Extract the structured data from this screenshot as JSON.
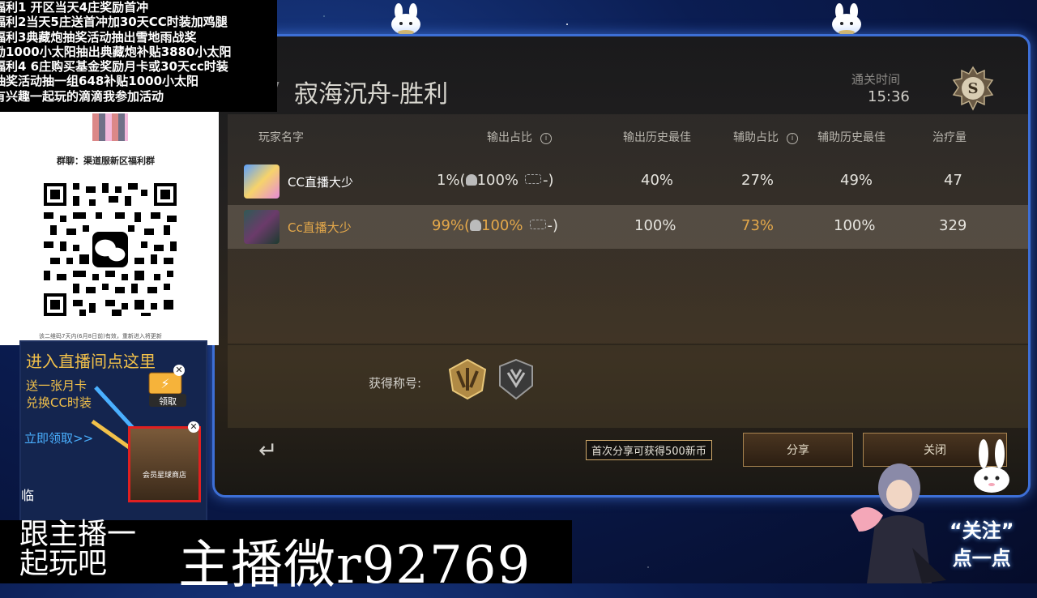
{
  "notice_lines": [
    "福利1 开区当天4庄奖励首冲",
    "福利2当天5庄送首冲加30天CC时装加鸡腿",
    "福利3典藏炮抽奖活动抽出雪地雨战奖",
    "励1000小太阳抽出典藏炮补贴3880小太阳",
    "福利4 6庄购买基金奖励月卡或30天cc时装",
    "抽奖活动抽一组648补贴1000小太阳",
    "有兴趣一起玩的滴滴我参加活动"
  ],
  "qr_panel": {
    "group_name": "群聊：渠道服新区福利群",
    "footer": "该二维码7天内(6月8日前)有效，重新进入将更新"
  },
  "game": {
    "title": "寂海沉舟-胜利",
    "clear_time_label": "通关时间",
    "clear_time_value": "15:36",
    "rank": "S",
    "headers": {
      "player_name": "玩家名字",
      "damage_share": "输出占比",
      "damage_best": "输出历史最佳",
      "support_share": "辅助占比",
      "support_best": "辅助历史最佳",
      "healing": "治疗量"
    },
    "rows": [
      {
        "name": "CC直播大少",
        "damage_pct": "1%(",
        "damage_team": "100%",
        "damage_tail": "-)",
        "damage_best": "40%",
        "support_pct": "27%",
        "support_best": "49%",
        "healing": "47"
      },
      {
        "name": "Cc直播大少",
        "damage_pct": "99%(",
        "damage_team": "100%",
        "damage_tail": "-)",
        "damage_best": "100%",
        "support_pct": "73%",
        "support_best": "100%",
        "healing": "329"
      }
    ],
    "earned_titles_label": "获得称号:",
    "share_tip": "首次分享可获得500新币",
    "share_button": "分享",
    "close_button": "关闭",
    "back_icon": "↵"
  },
  "promo": {
    "header": "进入直播间点这里",
    "line1": "送一张月卡",
    "line2": "兑换CC时装",
    "link": "立即领取>>",
    "claim_label": "领取",
    "shop_label": "会员星球商店",
    "side_char": "临"
  },
  "bottom": {
    "left_line1": "跟主播一",
    "left_line2": "起玩吧",
    "wechat": "主播微r92769"
  },
  "follow": {
    "line1": "“关注”",
    "line2": "点一点"
  },
  "colors": {
    "frame_border": "#3d6fd6",
    "gold_text": "#e4a84a",
    "promo_text": "#f2c14a",
    "link_blue": "#4ab0ff"
  }
}
